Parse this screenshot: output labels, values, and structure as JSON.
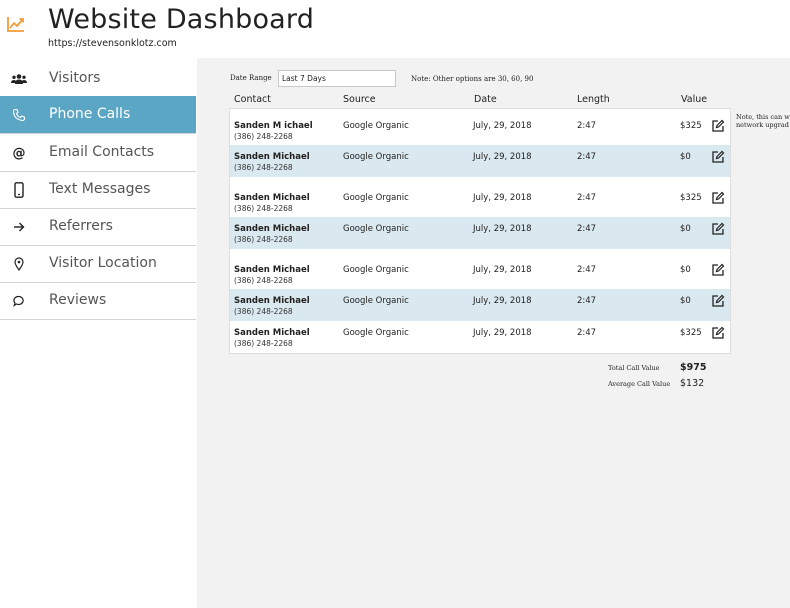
{
  "header": {
    "title": "Website Dashboard",
    "url": "https://stevensonklotz.com",
    "logo_icon": "trend-chart-icon",
    "accent_color": "#f39c3a"
  },
  "sidebar": {
    "active_color": "#5ca6c5",
    "items": [
      {
        "label": "Visitors",
        "icon": "users-icon"
      },
      {
        "label": "Phone Calls",
        "icon": "phone-icon",
        "active": true
      },
      {
        "label": "Email Contacts",
        "icon": "at-icon"
      },
      {
        "label": "Text Messages",
        "icon": "mobile-icon"
      },
      {
        "label": "Referrers",
        "icon": "arrow-right-icon"
      },
      {
        "label": "Visitor Location",
        "icon": "map-pin-icon"
      },
      {
        "label": "Reviews",
        "icon": "chat-bubble-icon"
      }
    ]
  },
  "filters": {
    "date_range_label": "Date Range",
    "date_range_value": "Last 7 Days",
    "note": "Note: Other options are 30, 60, 90"
  },
  "table": {
    "columns": [
      "Contact",
      "Source",
      "Date",
      "Length",
      "Value"
    ],
    "row_shade_color": "#dae8ef",
    "rows": [
      {
        "name": "Sanden M ichael",
        "phone": "(386) 248-2268",
        "source": "Google Organic",
        "date": "July, 29, 2018",
        "length": "2:47",
        "value": "$325"
      },
      {
        "name": "Sanden Michael",
        "phone": "(386) 248-2268",
        "source": "Google Organic",
        "date": "July, 29, 2018",
        "length": "2:47",
        "value": "$0"
      },
      {
        "name": "Sanden Michael",
        "phone": "(386) 248-2268",
        "source": "Google Organic",
        "date": "July, 29, 2018",
        "length": "2:47",
        "value": "$325"
      },
      {
        "name": "Sanden Michael",
        "phone": "(386) 248-2268",
        "source": "Google Organic",
        "date": "July, 29, 2018",
        "length": "2:47",
        "value": "$0"
      },
      {
        "name": "Sanden Michael",
        "phone": "(386) 248-2268",
        "source": "Google Organic",
        "date": "July, 29, 2018",
        "length": "2:47",
        "value": "$0"
      },
      {
        "name": "Sanden Michael",
        "phone": "(386) 248-2268",
        "source": "Google Organic",
        "date": "July, 29, 2018",
        "length": "2:47",
        "value": "$0"
      },
      {
        "name": "Sanden Michael",
        "phone": "(386) 248-2268",
        "source": "Google Organic",
        "date": "July, 29, 2018",
        "length": "2:47",
        "value": "$325"
      }
    ],
    "edit_icon": "edit-icon"
  },
  "side_note": {
    "line1": "Note, this can w",
    "line2": "network upgrad"
  },
  "summary": {
    "total_label": "Total Call Value",
    "total_value": "$975",
    "average_label": "Average Call Value",
    "average_value": "$132"
  }
}
